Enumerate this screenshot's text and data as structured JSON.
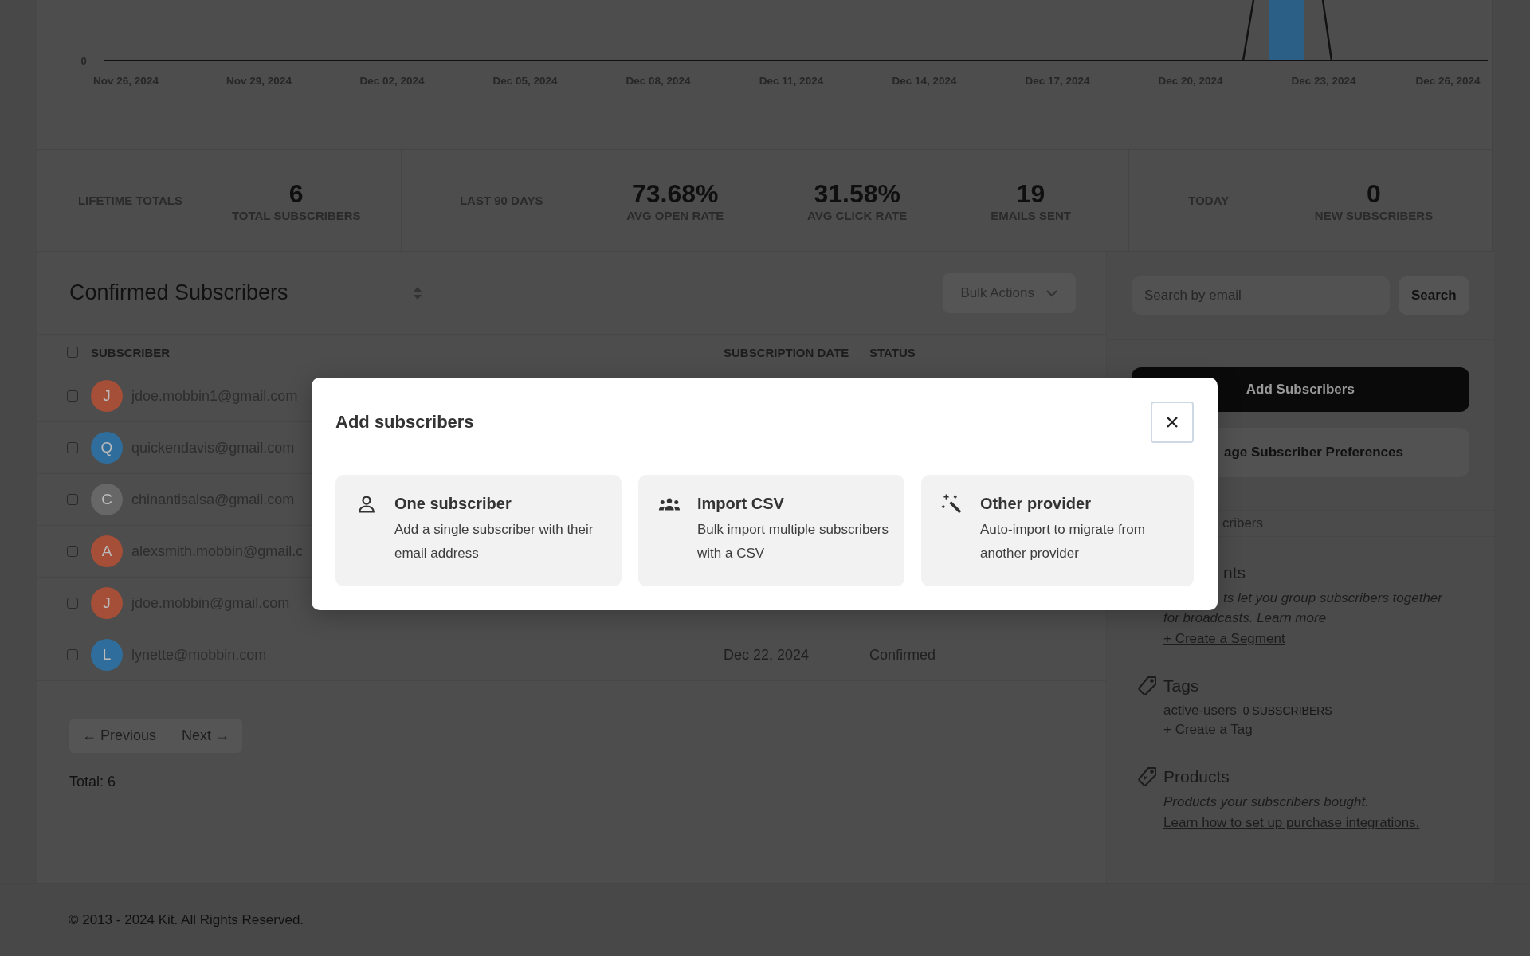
{
  "chart": {
    "y_tick": "0",
    "x_labels": [
      "Nov 26, 2024",
      "Nov 29, 2024",
      "Dec 02, 2024",
      "Dec 05, 2024",
      "Dec 08, 2024",
      "Dec 11, 2024",
      "Dec 14, 2024",
      "Dec 17, 2024",
      "Dec 20, 2024",
      "Dec 23, 2024",
      "Dec 26, 2024"
    ]
  },
  "stats": [
    {
      "label": "LIFETIME TOTALS",
      "items": [
        {
          "value": "6",
          "label": "TOTAL SUBSCRIBERS"
        }
      ]
    },
    {
      "label": "LAST 90 DAYS",
      "items": [
        {
          "value": "73.68%",
          "label": "AVG OPEN RATE"
        },
        {
          "value": "31.58%",
          "label": "AVG CLICK RATE"
        },
        {
          "value": "19",
          "label": "EMAILS SENT"
        }
      ]
    },
    {
      "label": "TODAY",
      "items": [
        {
          "value": "0",
          "label": "NEW SUBSCRIBERS"
        }
      ]
    }
  ],
  "list": {
    "title": "Confirmed Subscribers",
    "bulk_actions": "Bulk Actions",
    "select_all": {
      "checked": false
    },
    "columns": [
      "SUBSCRIBER",
      "SUBSCRIPTION DATE",
      "STATUS"
    ],
    "rows": [
      {
        "initial": "J",
        "color": "#a54e38",
        "email": "jdoe.mobbin1@gmail.com",
        "checked": false
      },
      {
        "initial": "Q",
        "color": "#2f6e9c",
        "email": "quickendavis@gmail.com",
        "checked": false
      },
      {
        "initial": "C",
        "color": "#676767",
        "email": "chinantisalsa@gmail.com",
        "checked": false
      },
      {
        "initial": "A",
        "color": "#a54e38",
        "email": "alexsmith.mobbin@gmail.c",
        "checked": false
      },
      {
        "initial": "J",
        "color": "#a54e38",
        "email": "jdoe.mobbin@gmail.com",
        "checked": false
      },
      {
        "initial": "L",
        "color": "#2f6e9c",
        "email": "lynette@mobbin.com",
        "checked": false,
        "date": "Dec 22, 2024",
        "status": "Confirmed"
      }
    ],
    "pagination": {
      "previous": "← Previous",
      "next": "Next →"
    },
    "total": "Total: 6"
  },
  "sidebar": {
    "search": {
      "placeholder": "Search by email",
      "button": "Search"
    },
    "add_button": "Add Subscribers",
    "preferences_button": "age Subscriber Preferences",
    "subscribers_link": "cribers",
    "segments": {
      "title": "nts",
      "description": "ts let you group subscribers together for broadcasts. Learn more",
      "create": "+ Create a Segment"
    },
    "tags": {
      "title": "Tags",
      "items": [
        {
          "name": "active-users",
          "count": "0 SUBSCRIBERS"
        }
      ],
      "create": "+ Create a Tag"
    },
    "products": {
      "title": "Products",
      "description": "Products your subscribers bought.",
      "link": "Learn how to set up purchase integrations."
    }
  },
  "footer": "© 2013 - 2024 Kit. All Rights Reserved.",
  "modal": {
    "title": "Add subscribers",
    "options": [
      {
        "kind": "single",
        "title": "One subscriber",
        "description": "Add a single subscriber with their email address"
      },
      {
        "kind": "csv",
        "title": "Import CSV",
        "description": "Bulk import multiple subscribers with a CSV"
      },
      {
        "kind": "provider",
        "title": "Other provider",
        "description": "Auto-import to migrate from another provider"
      }
    ]
  }
}
